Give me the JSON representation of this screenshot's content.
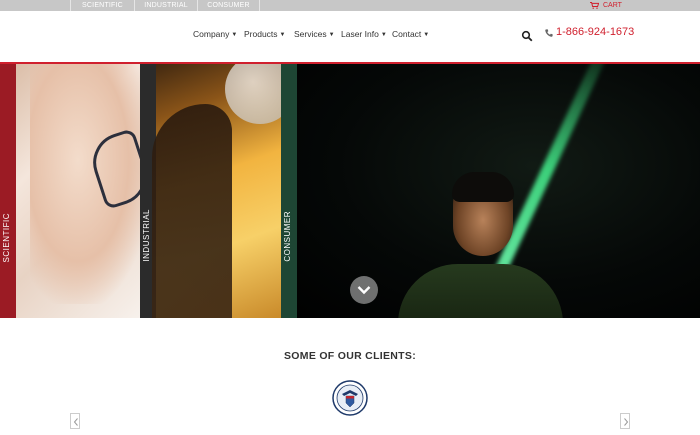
{
  "topbar": {
    "segments": [
      "Scientific",
      "Industrial",
      "Consumer"
    ],
    "cart_label": "Cart",
    "cart_icon": "cart-icon"
  },
  "header": {
    "nav": [
      {
        "label": "Company"
      },
      {
        "label": "Products"
      },
      {
        "label": "Services"
      },
      {
        "label": "Laser Info"
      },
      {
        "label": "Contact"
      }
    ],
    "search_icon": "search-icon",
    "phone_icon": "phone-icon",
    "phone": "1-866-924-1673"
  },
  "hero": {
    "panels": [
      {
        "label": "Scientific",
        "color": "#9b1b24"
      },
      {
        "label": "Industrial",
        "color": "#2b2b2b"
      },
      {
        "label": "Consumer",
        "color": "#1e4634"
      }
    ],
    "scroll_icon": "chevron-down-icon"
  },
  "clients": {
    "title": "SOME OF OUR CLIENTS:",
    "logo_icon": "dhs-seal-logo",
    "prev_icon": "chevron-left-icon",
    "next_icon": "chevron-right-icon"
  },
  "colors": {
    "accent": "#d0202e",
    "topbar": "#c7c7c7"
  }
}
